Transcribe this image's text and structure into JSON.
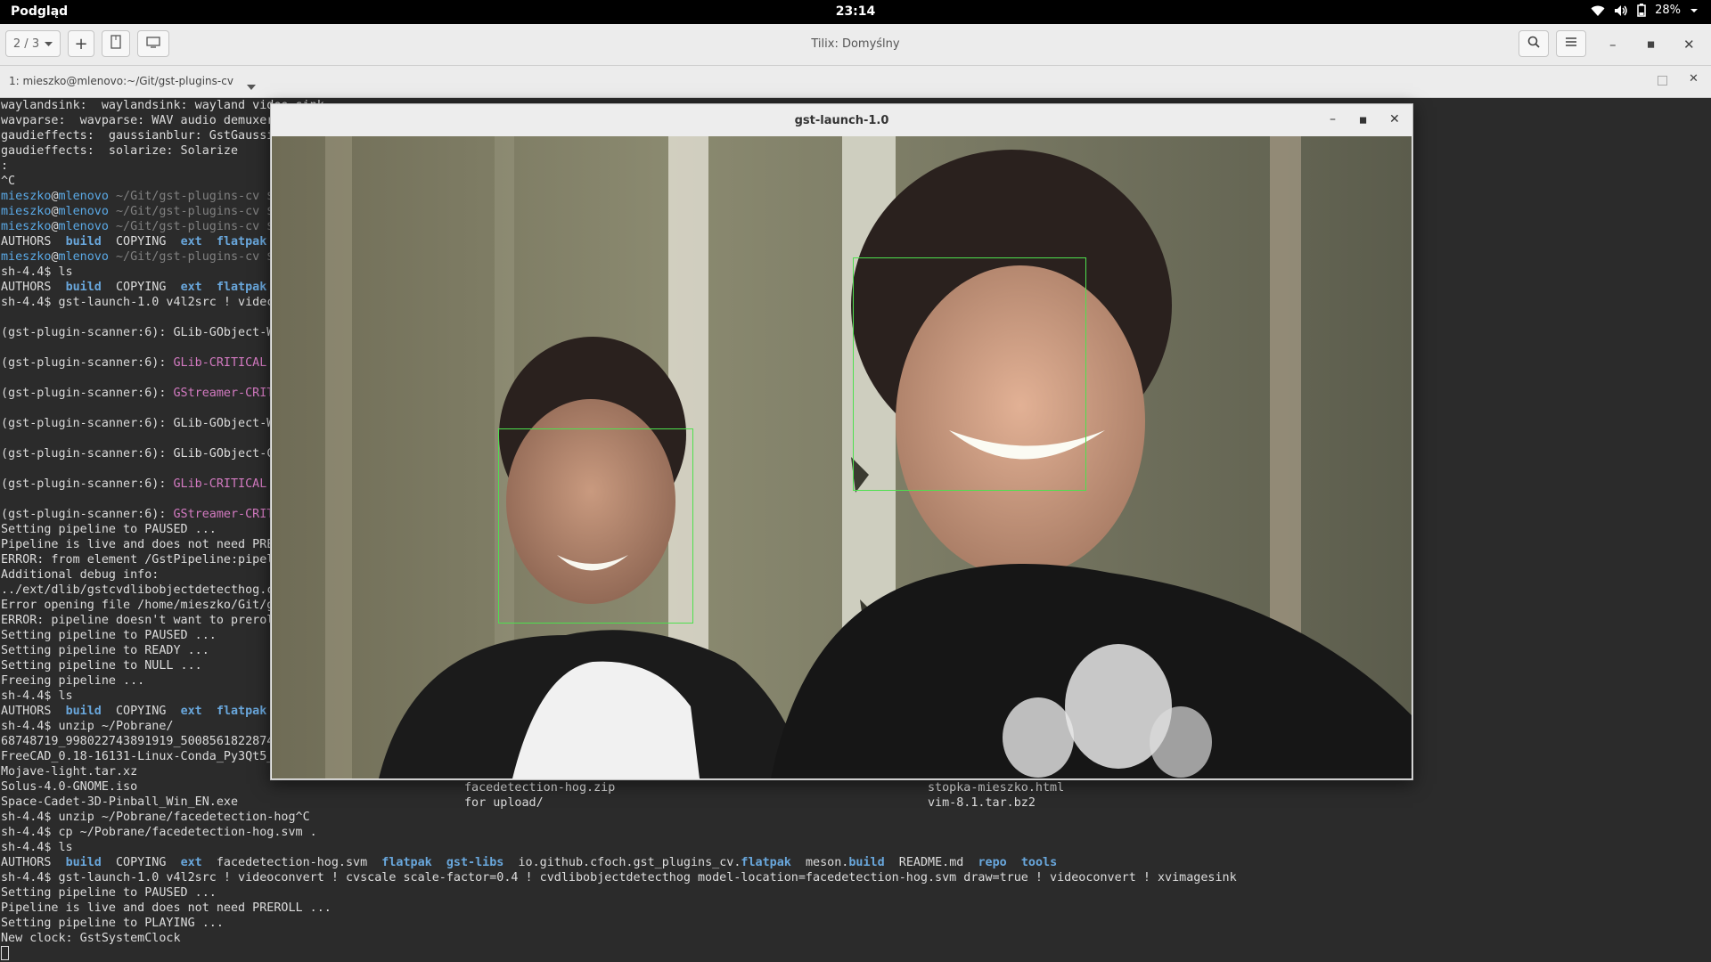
{
  "topbar": {
    "app_name": "Podgląd",
    "clock": "23:14",
    "battery": "28%",
    "icons": [
      "wifi-icon",
      "volume-icon",
      "battery-icon",
      "chevron-down-icon"
    ]
  },
  "tilix": {
    "session_counter": "2 / 3",
    "window_title": "Tilix: Domyślny",
    "terminal_title": "1: mieszko@mlenovo:~/Git/gst-plugins-cv",
    "buttons": [
      "add-session",
      "split-horizontal",
      "split-vertical",
      "search",
      "menu",
      "minimize",
      "maximize",
      "close"
    ]
  },
  "terminal": {
    "lines": [
      "waylandsink:  waylandsink: wayland video sink",
      "wavparse:  wavparse: WAV audio demuxer",
      "gaudieffects:  gaussianblur: GstGaussianBlur",
      "gaudieffects:  solarize: Solarize",
      ":",
      "^C",
      "mieszko@mlenovo ~/Git/gst-plugins-cv $",
      "mieszko@mlenovo ~/Git/gst-plugins-cv $",
      "mieszko@mlenovo ~/Git/gst-plugins-cv $",
      "AUTHORS  build  COPYING  ext  flatpak",
      "mieszko@mlenovo ~/Git/gst-plugins-cv $",
      "sh-4.4$ ls",
      "AUTHORS  build  COPYING  ext  flatpak",
      "sh-4.4$ gst-launch-1.0 v4l2src ! videc",
      "",
      "(gst-plugin-scanner:6): GLib-GObject-W",
      "",
      "(gst-plugin-scanner:6): GLib-CRITICAL",
      "",
      "(gst-plugin-scanner:6): GStreamer-CRIT",
      "",
      "(gst-plugin-scanner:6): GLib-GObject-W",
      "",
      "(gst-plugin-scanner:6): GLib-GObject-C",
      "",
      "(gst-plugin-scanner:6): GLib-CRITICAL",
      "",
      "(gst-plugin-scanner:6): GStreamer-CRIT",
      "Setting pipeline to PAUSED ...",
      "Pipeline is live and does not need PRE",
      "ERROR: from element /GstPipeline:pipel",
      "Additional debug info:",
      "../ext/dlib/gstcvdlibobjectdetecthog.c",
      "Error opening file /home/mieszko/Git/g",
      "ERROR: pipeline doesn't want to prerol",
      "Setting pipeline to PAUSED ...",
      "Setting pipeline to READY ...",
      "Setting pipeline to NULL ...",
      "Freeing pipeline ...",
      "sh-4.4$ ls",
      "AUTHORS  build  COPYING  ext  flatpak",
      "sh-4.4$ unzip ~/Pobrane/",
      "68748719_998022743891919_5008561822874",
      "FreeCAD_0.18-16131-Linux-Conda_Py3Qt5_",
      "Mojave-light.tar.xz",
      "Solus-4.0-GNOME.iso",
      "Space-Cadet-3D-Pinball_Win_EN.exe",
      "sh-4.4$ unzip ~/Pobrane/facedetection-hog^C",
      "sh-4.4$ cp ~/Pobrane/facedetection-hog.svm .",
      "sh-4.4$ ls",
      "AUTHORS  build  COPYING  ext  facedetection-hog.svm  flatpak  gst-libs  io.github.cfoch.gst_plugins_cv.flatpak  meson.build  README.md  repo  tools",
      "sh-4.4$ gst-launch-1.0 v4l2src ! videoconvert ! cvscale scale-factor=0.4 ! cvdlibobjectdetecthog model-location=facedetection-hog.svm draw=true ! videoconvert ! xvimagesink",
      "Setting pipeline to PAUSED ...",
      "Pipeline is live and does not need PREROLL ...",
      "Setting pipeline to PLAYING ...",
      "New clock: GstSystemClock"
    ],
    "listing_col2": [
      "facedetection-hog.zip",
      "for upload/"
    ],
    "listing_col3": [
      "stopka-mieszko.html",
      "vim-8.1.tar.bz2"
    ]
  },
  "video_window": {
    "title": "gst-launch-1.0",
    "detected_faces": 2
  },
  "colors": {
    "terminal_bg": "#2b2b2b",
    "terminal_fg": "#dcdcdc",
    "prompt_user": "#5aa9e6",
    "detection_box": "#4ee04e"
  }
}
